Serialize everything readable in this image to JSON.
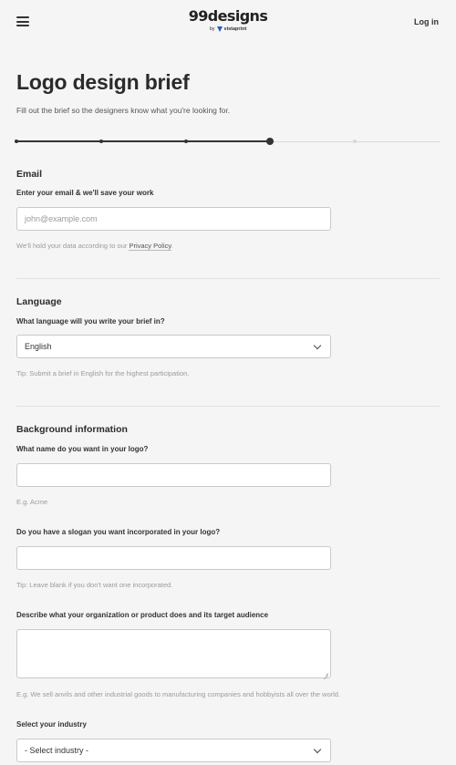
{
  "header": {
    "logo_main": "99designs",
    "logo_by": "by",
    "logo_sub_brand": "vistaprint",
    "login_label": "Log in"
  },
  "page": {
    "title": "Logo design brief",
    "subtitle": "Fill out the brief so the designers know what you're looking for."
  },
  "progress": {
    "steps_total": 5,
    "current_step": 4
  },
  "email_section": {
    "title": "Email",
    "label": "Enter your email & we'll save your work",
    "placeholder": "john@example.com",
    "hint_prefix": "We'll hold your data according to our ",
    "hint_link": "Privacy Policy",
    "hint_suffix": "."
  },
  "language_section": {
    "title": "Language",
    "label": "What language will you write your brief in?",
    "selected": "English",
    "hint": "Tip: Submit a brief in English for the highest participation."
  },
  "background_section": {
    "title": "Background information",
    "name_label": "What name do you want in your logo?",
    "name_hint": "E.g. Acme",
    "slogan_label": "Do you have a slogan you want incorporated in your logo?",
    "slogan_hint": "Tip: Leave blank if you don't want one incorporated.",
    "describe_label": "Describe what your organization or product does and its target audience",
    "describe_hint": "E.g. We sell anvils and other industrial goods to manufacturing companies and hobbyists all over the world.",
    "industry_label": "Select your industry",
    "industry_selected": "- Select industry -"
  },
  "icons": {
    "menu": "hamburger-menu-icon",
    "select": "chevron-down-icon",
    "resize": "resize-handle-icon"
  },
  "colors": {
    "background": "#f5f5f5",
    "progress_done": "#333333",
    "progress_todo": "#d8d8d8",
    "brand_mark": "#1d5fbf"
  }
}
